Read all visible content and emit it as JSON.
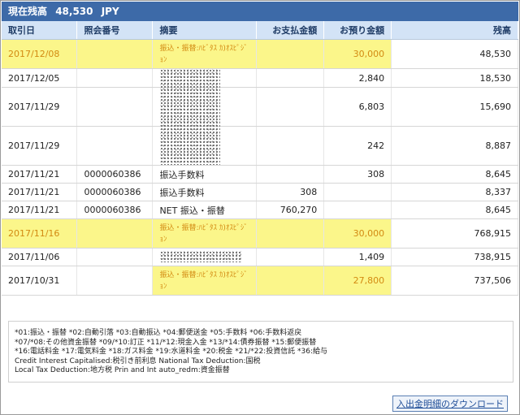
{
  "balance": {
    "label": "現在残高",
    "amount": "48,530",
    "currency": "JPY"
  },
  "table": {
    "columns": [
      "取引日",
      "照会番号",
      "摘要",
      "お支払金額",
      "お預り金額",
      "残高"
    ],
    "rows": [
      {
        "date": "2017/12/08",
        "ref": "",
        "desc": "振込・振替:ﾊﾋﾞﾀｽ ｶ)ｵｽﾋﾟｼﾞｮﾝ",
        "pay": "",
        "deposit": "30,000",
        "balance": "48,530"
      },
      {
        "date": "2017/12/05",
        "ref": "",
        "desc": "",
        "pay": "",
        "deposit": "2,840",
        "balance": "18,530"
      },
      {
        "date": "2017/11/29",
        "ref": "",
        "desc": "",
        "pay": "",
        "deposit": "6,803",
        "balance": "15,690"
      },
      {
        "date": "2017/11/29",
        "ref": "",
        "desc": "",
        "pay": "",
        "deposit": "242",
        "balance": "8,887"
      },
      {
        "date": "2017/11/21",
        "ref": "0000060386",
        "desc": "振込手数料",
        "pay": "",
        "deposit": "308",
        "balance": "8,645"
      },
      {
        "date": "2017/11/21",
        "ref": "0000060386",
        "desc": "振込手数料",
        "pay": "308",
        "deposit": "",
        "balance": "8,337"
      },
      {
        "date": "2017/11/21",
        "ref": "0000060386",
        "desc": "NET 振込・振替",
        "pay": "760,270",
        "deposit": "",
        "balance": "8,645"
      },
      {
        "date": "2017/11/16",
        "ref": "",
        "desc": "振込・振替:ﾊﾋﾞﾀｽ ｶ)ｵｽﾋﾟｼﾞｮﾝ",
        "pay": "",
        "deposit": "30,000",
        "balance": "768,915"
      },
      {
        "date": "2017/11/06",
        "ref": "",
        "desc": "",
        "pay": "",
        "deposit": "1,409",
        "balance": "738,915"
      },
      {
        "date": "2017/10/31",
        "ref": "",
        "desc": "振込・振替:ﾊﾋﾞﾀｽ ｶ)ｵｽﾋﾟｼﾞｮﾝ",
        "pay": "",
        "deposit": "27,800",
        "balance": "737,506"
      }
    ]
  },
  "notes": [
    "*01:振込・振替 *02:自動引落 *03:自動振込 *04:郵便送金 *05:手数料 *06:手数料返戻",
    "*07/*08:その他資金振替 *09/*10:訂正 *11/*12:現金入金 *13/*14:債券振替 *15:郵便振替",
    "*16:電話料金 *17:電気料金 *18:ガス料金 *19:水道料金 *20:税金 *21/*22:投資信託 *36:給与",
    "Credit Interest Capitalised:税引き前利息 National Tax Deduction:国税",
    "Local Tax Deduction:地方税 Prin and Int auto_redm:資金振替"
  ],
  "download_label": "入出金明細のダウンロード"
}
